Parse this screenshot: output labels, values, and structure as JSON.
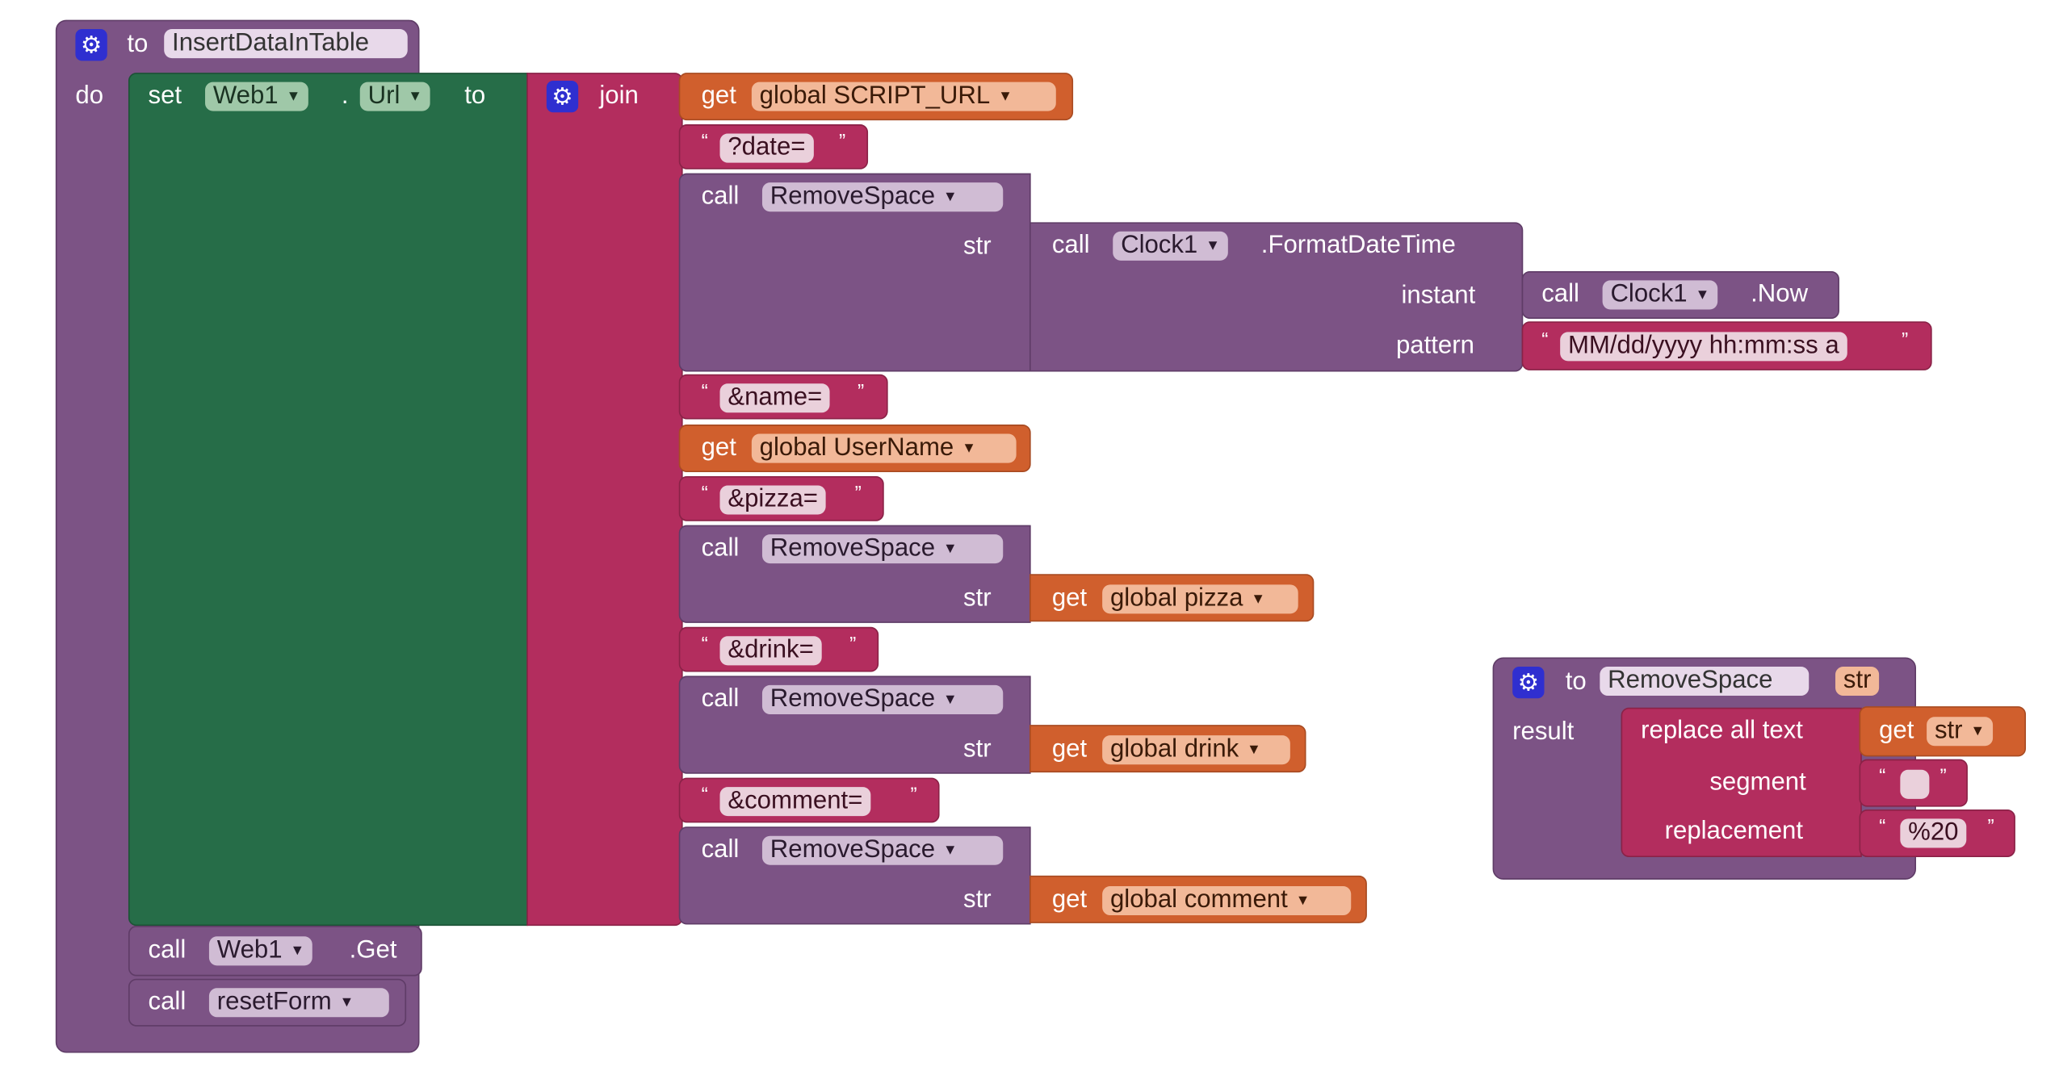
{
  "procedure_main": {
    "keyword_to": "to",
    "name": "InsertDataInTable",
    "keyword_do": "do",
    "gear_icon": "gear-icon",
    "set_block": {
      "keyword_set": "set",
      "component": "Web1",
      "dot": ".",
      "property": "Url",
      "keyword_to": "to"
    },
    "join_block": {
      "keyword_join": "join",
      "get_script_url": {
        "keyword_get": "get",
        "variable": "global SCRIPT_URL"
      },
      "text_date": "?date=",
      "call_remove_space_1": {
        "keyword_call": "call",
        "procedure": "RemoveSpace",
        "param_label": "str",
        "format_datetime": {
          "keyword_call": "call",
          "component": "Clock1",
          "method": ".FormatDateTime",
          "instant_label": "instant",
          "pattern_label": "pattern",
          "clock_now": {
            "keyword_call": "call",
            "component": "Clock1",
            "method": ".Now"
          },
          "pattern_value": "MM/dd/yyyy hh:mm:ss a"
        }
      },
      "text_name": "&name=",
      "get_username": {
        "keyword_get": "get",
        "variable": "global UserName"
      },
      "text_pizza": "&pizza=",
      "call_remove_space_2": {
        "keyword_call": "call",
        "procedure": "RemoveSpace",
        "param_label": "str",
        "keyword_get": "get",
        "variable": "global pizza"
      },
      "text_drink": "&drink=",
      "call_remove_space_3": {
        "keyword_call": "call",
        "procedure": "RemoveSpace",
        "param_label": "str",
        "keyword_get": "get",
        "variable": "global drink"
      },
      "text_comment": "&comment=",
      "call_remove_space_4": {
        "keyword_call": "call",
        "procedure": "RemoveSpace",
        "param_label": "str",
        "keyword_get": "get",
        "variable": "global comment"
      }
    },
    "call_web_get": {
      "keyword_call": "call",
      "component": "Web1",
      "method": ".Get"
    },
    "call_reset_form": {
      "keyword_call": "call",
      "procedure": "resetForm"
    }
  },
  "procedure_remove_space": {
    "keyword_to": "to",
    "name": "RemoveSpace",
    "param": "str",
    "keyword_result": "result",
    "gear_icon": "gear-icon",
    "replace_all": {
      "label": "replace all text",
      "get_str": {
        "keyword_get": "get",
        "variable": "str"
      },
      "segment_label": "segment",
      "segment_value": " ",
      "replacement_label": "replacement",
      "replacement_value": "%20"
    }
  },
  "glyphs": {
    "dropdown": "▼",
    "open_quote": "“",
    "close_quote": "”",
    "gear": "⚙"
  },
  "colors": {
    "procedure": "#7c5385",
    "component_set": "#266d48",
    "text": "#b32d5e",
    "variable": "#d05f2d",
    "gear": "#2f2fd0"
  }
}
